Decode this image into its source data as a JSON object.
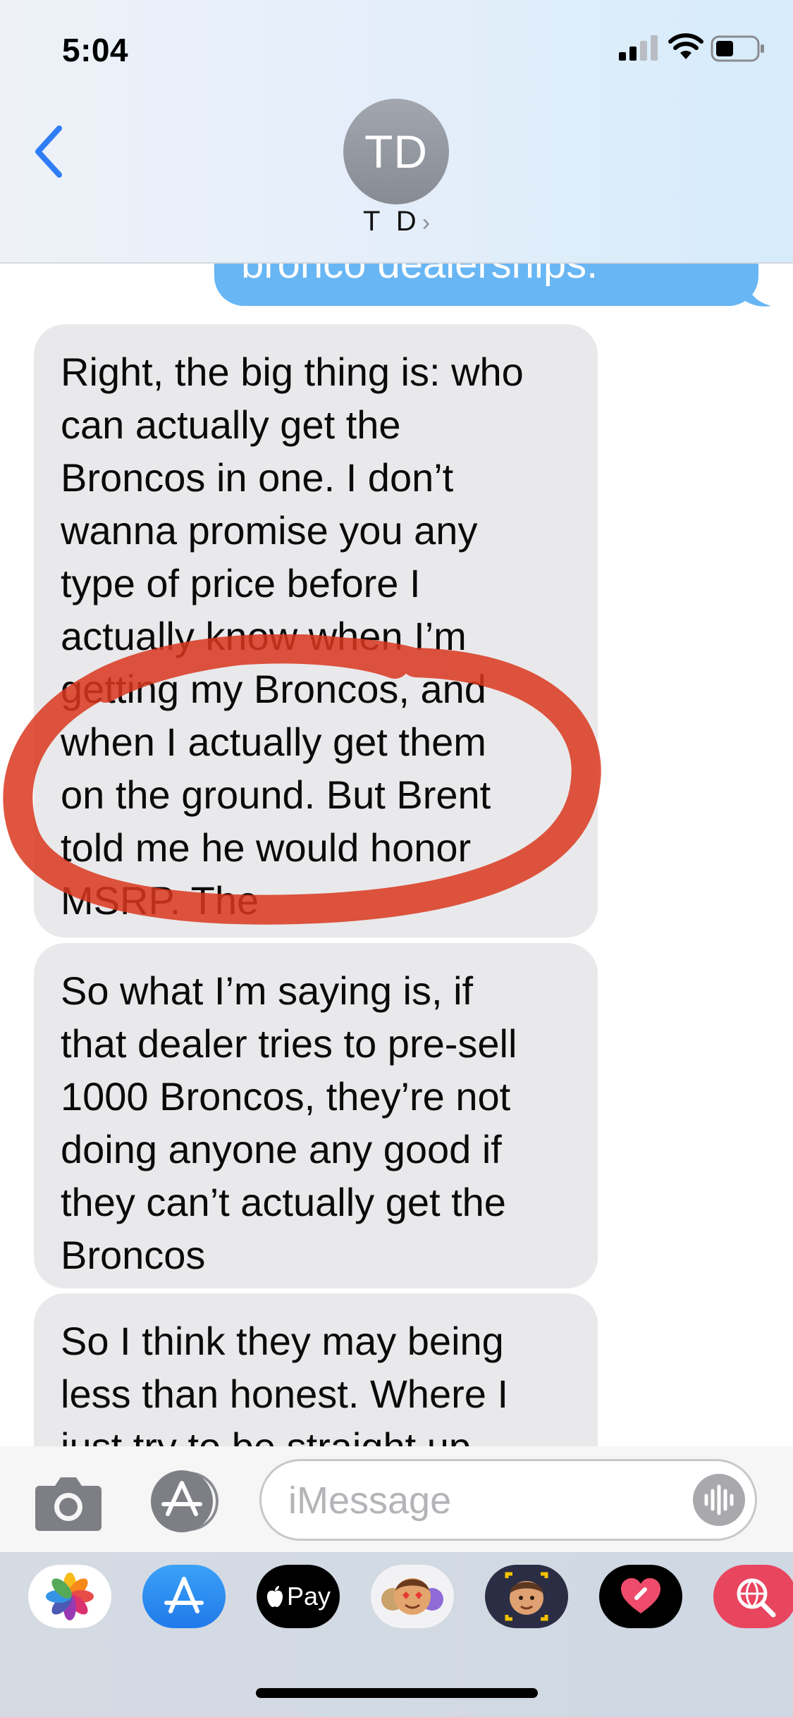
{
  "status_bar": {
    "time": "5:04"
  },
  "header": {
    "avatar_initials": "TD",
    "contact_name": "T D",
    "chevron": "›"
  },
  "conversation": {
    "sent_partial": "bronco dealerships.",
    "received": [
      {
        "lines": [
          "Right, the big thing is: who",
          "can actually get the",
          "Broncos in one. I don’t",
          "wanna promise you any",
          "type of price before I",
          "actually know when I’m",
          "getting my Broncos, and",
          "when I actually get them",
          "on the ground. But Brent",
          "told me he would honor",
          "MSRP. The"
        ]
      },
      {
        "lines": [
          "So what I’m saying is, if",
          "that dealer tries to pre-sell",
          "1000 Broncos, they’re not",
          "doing anyone any good if",
          "they can’t actually get the",
          "Broncos"
        ]
      },
      {
        "lines": [
          "So I think they may being",
          "less than honest. Where I",
          "just try to be straight up"
        ]
      }
    ],
    "annotation": "red-circle-highlight"
  },
  "input_bar": {
    "placeholder": "iMessage"
  },
  "app_drawer": {
    "apps": [
      {
        "name": "Photos",
        "icon": "photos-icon"
      },
      {
        "name": "App Store",
        "icon": "appstore-icon"
      },
      {
        "name": "Apple Pay",
        "icon": "applepay-icon",
        "label": "Pay"
      },
      {
        "name": "Memoji Stickers",
        "icon": "memoji-stickers-icon"
      },
      {
        "name": "Memoji",
        "icon": "memoji-icon"
      },
      {
        "name": "Digital Touch",
        "icon": "digital-touch-icon"
      },
      {
        "name": "Search Images",
        "icon": "image-search-icon"
      }
    ]
  },
  "colors": {
    "sent_bubble": "#68b6f4",
    "received_bubble": "#e9e9eb",
    "accent": "#2f7df6",
    "annotation": "#d9371f"
  }
}
